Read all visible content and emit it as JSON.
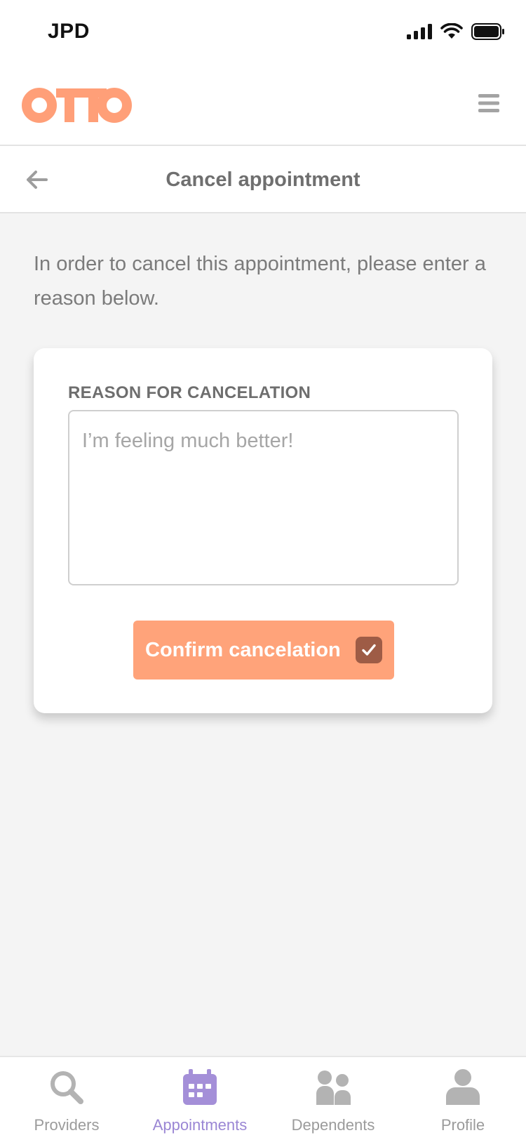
{
  "status_bar": {
    "carrier": "JPD",
    "icons": [
      "signal-icon",
      "wifi-icon",
      "battery-icon"
    ]
  },
  "header": {
    "logo_text": "OTTO",
    "menu_icon": "hamburger-menu-icon"
  },
  "title_bar": {
    "back_icon": "arrow-left-icon",
    "title": "Cancel appointment"
  },
  "intro_text": "In order to cancel this appointment, please enter a reason below.",
  "form": {
    "label": "REASON FOR CANCELATION",
    "reason_value": "",
    "reason_placeholder": "I’m feeling much better!",
    "confirm_label": "Confirm cancelation",
    "confirm_icon": "checkbox-checked-icon"
  },
  "bottom_nav": {
    "items": [
      {
        "label": "Providers",
        "icon": "search-icon",
        "active": false
      },
      {
        "label": "Appointments",
        "icon": "calendar-icon",
        "active": true
      },
      {
        "label": "Dependents",
        "icon": "people-icon",
        "active": false
      },
      {
        "label": "Profile",
        "icon": "person-icon",
        "active": false
      }
    ]
  },
  "colors": {
    "brand": "#ff9f78",
    "button": "#ffa37a",
    "checkbox": "#9e5c46",
    "nav_active": "#9a86d4",
    "nav_inactive": "#9b9b9b",
    "background": "#f4f4f4"
  }
}
